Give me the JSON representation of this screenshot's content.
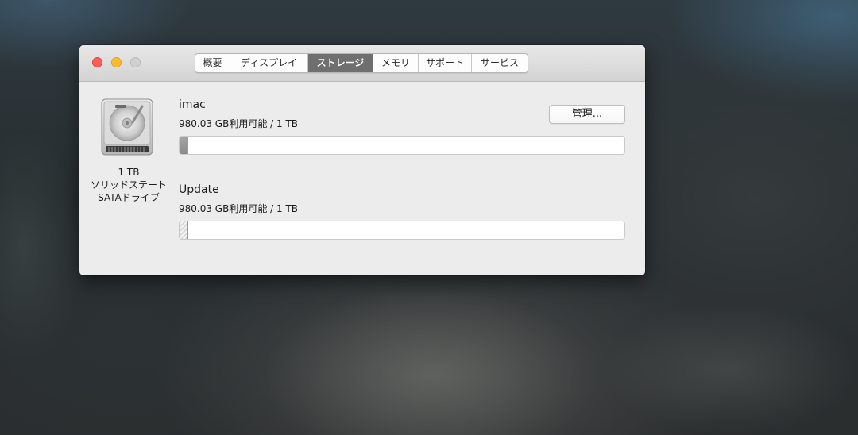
{
  "window": {
    "tabs": [
      {
        "label": "概要",
        "active": false
      },
      {
        "label": "ディスプレイ",
        "active": false
      },
      {
        "label": "ストレージ",
        "active": true
      },
      {
        "label": "メモリ",
        "active": false
      },
      {
        "label": "サポート",
        "active": false
      },
      {
        "label": "サービス",
        "active": false
      }
    ]
  },
  "drive": {
    "icon": "hard-drive-icon",
    "capacity": "1 TB",
    "type_line1": "ソリッドステート",
    "type_line2": "SATAドライブ"
  },
  "volumes": [
    {
      "name": "imac",
      "availability": "980.03 GB利用可能 / 1 TB",
      "used_fraction": 0.02,
      "bar_style": "solid"
    },
    {
      "name": "Update",
      "availability": "980.03 GB利用可能 / 1 TB",
      "used_fraction": 0.02,
      "bar_style": "hatched"
    }
  ],
  "manage_button": {
    "label": "管理..."
  },
  "colors": {
    "close": "#fd5f57",
    "minimize": "#febc2e",
    "zoom_disabled": "#d0d0d0",
    "active_tab": "#6f6f6f",
    "window_bg": "#ececec"
  }
}
